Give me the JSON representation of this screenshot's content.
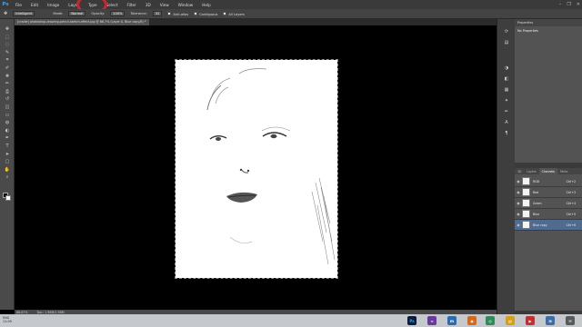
{
  "menubar": {
    "logo": "Ps",
    "items": [
      "File",
      "Edit",
      "Image",
      "Layer",
      "Type",
      "Select",
      "Filter",
      "3D",
      "View",
      "Window",
      "Help"
    ],
    "window_controls": [
      "–",
      "❐",
      "✕"
    ]
  },
  "options": {
    "preset": "Intelligent",
    "mode_label": "Mode:",
    "mode_value": "Normal",
    "opacity_label": "Opacity:",
    "opacity_value": "100%",
    "tolerance_label": "Tolerance:",
    "tolerance_value": "32",
    "anti_alias_label": "Anti-alias",
    "contiguous_label": "Contiguous",
    "all_layers_label": "All Layers"
  },
  "document": {
    "tab_title": "[cradle] photoshop-drawing-pencil-sketch-effect.jpg @ 66.7% (Layer 0, Blue copy/8) *"
  },
  "status": {
    "zoom": "66.67%",
    "doc_size": "Doc: 1.98M/1.98M"
  },
  "properties": {
    "header": "Properties",
    "body": "No Properties"
  },
  "channels_panel": {
    "tabs": [
      "3D",
      "Layers",
      "Channels",
      "Paths"
    ],
    "active_tab": "Channels",
    "rows": [
      {
        "name": "RGB",
        "key": "Ctrl+2"
      },
      {
        "name": "Red",
        "key": "Ctrl+3"
      },
      {
        "name": "Green",
        "key": "Ctrl+4"
      },
      {
        "name": "Blue",
        "key": "Ctrl+5"
      },
      {
        "name": "Blue copy",
        "key": "Ctrl+6"
      }
    ]
  },
  "taskbar": {
    "time": "11:09",
    "date": "2015-03-15",
    "tray_lang": "ENG"
  },
  "icons": {
    "tools": [
      "move-icon",
      "marquee-icon",
      "lasso-icon",
      "quick-select-icon",
      "crop-icon",
      "eyedropper-icon",
      "spot-heal-icon",
      "brush-icon",
      "stamp-icon",
      "history-brush-icon",
      "eraser-icon",
      "gradient-icon",
      "blur-icon",
      "dodge-icon",
      "pen-icon",
      "type-icon",
      "path-select-icon",
      "shape-icon",
      "hand-icon",
      "zoom-icon"
    ],
    "tool_glyphs": [
      "✥",
      "⬚",
      "◌",
      "✎",
      "⌗",
      "✐",
      "✚",
      "✏",
      "⎙",
      "↺",
      "◫",
      "▭",
      "◍",
      "◐",
      "✒",
      "T",
      "➤",
      "▢",
      "✋",
      "⌕"
    ]
  }
}
